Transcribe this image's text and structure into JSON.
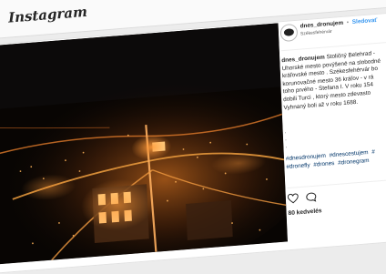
{
  "app": {
    "logo_text": "Instagram"
  },
  "post": {
    "username": "dnes_dronujem",
    "separator": "•",
    "follow_label": "Sledovať",
    "location": "Székesfehérvár",
    "caption_user": "dnes_dronujem",
    "caption_lines": [
      "Stoličný Belehrad -",
      "Uhorské mesto povýšené na slobodné",
      "kráľovské mesto . Székesfehérvár bo",
      "korunovačné mesto 36 kráľov - v rá",
      "toho prvého - Štefana I. V roku 154",
      "dobili Turci , ktorý mesto zdevasto",
      "Vyhnaný boli až v roku 1688."
    ],
    "bullets": [
      ".",
      ".",
      "."
    ],
    "hashtags": [
      "#dnesdronujem",
      "#dnescestujem",
      "#",
      "#dronefly",
      "#drones",
      "#dronegram"
    ],
    "likes": "80 kedvelés",
    "icons": {
      "like": "heart-icon",
      "comment": "comment-icon"
    }
  }
}
